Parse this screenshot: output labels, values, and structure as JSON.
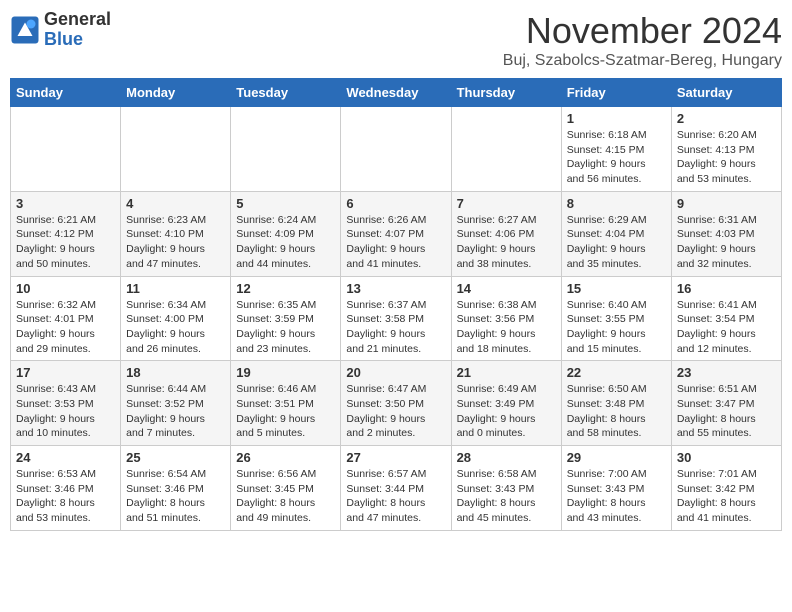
{
  "header": {
    "logo_general": "General",
    "logo_blue": "Blue",
    "month_title": "November 2024",
    "location": "Buj, Szabolcs-Szatmar-Bereg, Hungary"
  },
  "weekdays": [
    "Sunday",
    "Monday",
    "Tuesday",
    "Wednesday",
    "Thursday",
    "Friday",
    "Saturday"
  ],
  "weeks": [
    [
      {
        "day": "",
        "info": ""
      },
      {
        "day": "",
        "info": ""
      },
      {
        "day": "",
        "info": ""
      },
      {
        "day": "",
        "info": ""
      },
      {
        "day": "",
        "info": ""
      },
      {
        "day": "1",
        "info": "Sunrise: 6:18 AM\nSunset: 4:15 PM\nDaylight: 9 hours\nand 56 minutes."
      },
      {
        "day": "2",
        "info": "Sunrise: 6:20 AM\nSunset: 4:13 PM\nDaylight: 9 hours\nand 53 minutes."
      }
    ],
    [
      {
        "day": "3",
        "info": "Sunrise: 6:21 AM\nSunset: 4:12 PM\nDaylight: 9 hours\nand 50 minutes."
      },
      {
        "day": "4",
        "info": "Sunrise: 6:23 AM\nSunset: 4:10 PM\nDaylight: 9 hours\nand 47 minutes."
      },
      {
        "day": "5",
        "info": "Sunrise: 6:24 AM\nSunset: 4:09 PM\nDaylight: 9 hours\nand 44 minutes."
      },
      {
        "day": "6",
        "info": "Sunrise: 6:26 AM\nSunset: 4:07 PM\nDaylight: 9 hours\nand 41 minutes."
      },
      {
        "day": "7",
        "info": "Sunrise: 6:27 AM\nSunset: 4:06 PM\nDaylight: 9 hours\nand 38 minutes."
      },
      {
        "day": "8",
        "info": "Sunrise: 6:29 AM\nSunset: 4:04 PM\nDaylight: 9 hours\nand 35 minutes."
      },
      {
        "day": "9",
        "info": "Sunrise: 6:31 AM\nSunset: 4:03 PM\nDaylight: 9 hours\nand 32 minutes."
      }
    ],
    [
      {
        "day": "10",
        "info": "Sunrise: 6:32 AM\nSunset: 4:01 PM\nDaylight: 9 hours\nand 29 minutes."
      },
      {
        "day": "11",
        "info": "Sunrise: 6:34 AM\nSunset: 4:00 PM\nDaylight: 9 hours\nand 26 minutes."
      },
      {
        "day": "12",
        "info": "Sunrise: 6:35 AM\nSunset: 3:59 PM\nDaylight: 9 hours\nand 23 minutes."
      },
      {
        "day": "13",
        "info": "Sunrise: 6:37 AM\nSunset: 3:58 PM\nDaylight: 9 hours\nand 21 minutes."
      },
      {
        "day": "14",
        "info": "Sunrise: 6:38 AM\nSunset: 3:56 PM\nDaylight: 9 hours\nand 18 minutes."
      },
      {
        "day": "15",
        "info": "Sunrise: 6:40 AM\nSunset: 3:55 PM\nDaylight: 9 hours\nand 15 minutes."
      },
      {
        "day": "16",
        "info": "Sunrise: 6:41 AM\nSunset: 3:54 PM\nDaylight: 9 hours\nand 12 minutes."
      }
    ],
    [
      {
        "day": "17",
        "info": "Sunrise: 6:43 AM\nSunset: 3:53 PM\nDaylight: 9 hours\nand 10 minutes."
      },
      {
        "day": "18",
        "info": "Sunrise: 6:44 AM\nSunset: 3:52 PM\nDaylight: 9 hours\nand 7 minutes."
      },
      {
        "day": "19",
        "info": "Sunrise: 6:46 AM\nSunset: 3:51 PM\nDaylight: 9 hours\nand 5 minutes."
      },
      {
        "day": "20",
        "info": "Sunrise: 6:47 AM\nSunset: 3:50 PM\nDaylight: 9 hours\nand 2 minutes."
      },
      {
        "day": "21",
        "info": "Sunrise: 6:49 AM\nSunset: 3:49 PM\nDaylight: 9 hours\nand 0 minutes."
      },
      {
        "day": "22",
        "info": "Sunrise: 6:50 AM\nSunset: 3:48 PM\nDaylight: 8 hours\nand 58 minutes."
      },
      {
        "day": "23",
        "info": "Sunrise: 6:51 AM\nSunset: 3:47 PM\nDaylight: 8 hours\nand 55 minutes."
      }
    ],
    [
      {
        "day": "24",
        "info": "Sunrise: 6:53 AM\nSunset: 3:46 PM\nDaylight: 8 hours\nand 53 minutes."
      },
      {
        "day": "25",
        "info": "Sunrise: 6:54 AM\nSunset: 3:46 PM\nDaylight: 8 hours\nand 51 minutes."
      },
      {
        "day": "26",
        "info": "Sunrise: 6:56 AM\nSunset: 3:45 PM\nDaylight: 8 hours\nand 49 minutes."
      },
      {
        "day": "27",
        "info": "Sunrise: 6:57 AM\nSunset: 3:44 PM\nDaylight: 8 hours\nand 47 minutes."
      },
      {
        "day": "28",
        "info": "Sunrise: 6:58 AM\nSunset: 3:43 PM\nDaylight: 8 hours\nand 45 minutes."
      },
      {
        "day": "29",
        "info": "Sunrise: 7:00 AM\nSunset: 3:43 PM\nDaylight: 8 hours\nand 43 minutes."
      },
      {
        "day": "30",
        "info": "Sunrise: 7:01 AM\nSunset: 3:42 PM\nDaylight: 8 hours\nand 41 minutes."
      }
    ]
  ]
}
